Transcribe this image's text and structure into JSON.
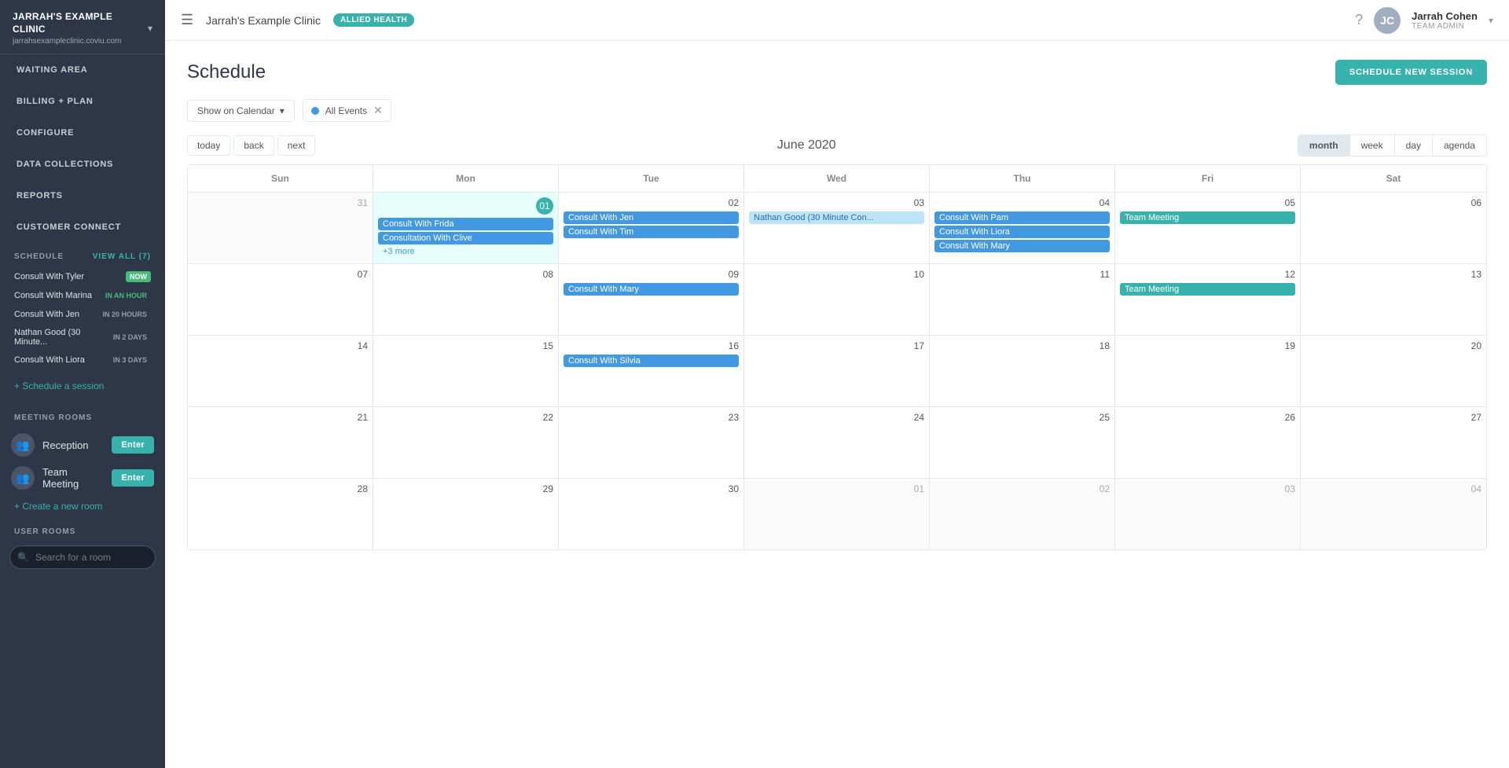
{
  "sidebar": {
    "brand": {
      "name": "JARRAH'S EXAMPLE CLINIC",
      "url": "jarrahsexampleclinic.coviu.com"
    },
    "navItems": [
      {
        "id": "waiting-area",
        "label": "WAITING AREA"
      },
      {
        "id": "billing-plan",
        "label": "BILLING + PLAN"
      },
      {
        "id": "configure",
        "label": "CONFIGURE"
      },
      {
        "id": "data-collections",
        "label": "DATA COLLECTIONS"
      },
      {
        "id": "reports",
        "label": "REPORTS"
      },
      {
        "id": "customer-connect",
        "label": "CUSTOMER CONNECT"
      }
    ],
    "schedule": {
      "header": "SCHEDULE",
      "viewAllLabel": "VIEW ALL (7)",
      "items": [
        {
          "name": "Consult With Tyler",
          "badge": "NOW",
          "badgeType": "now"
        },
        {
          "name": "Consult With Marina",
          "badge": "IN AN HOUR",
          "badgeType": "hour"
        },
        {
          "name": "Consult With Jen",
          "badge": "IN 20 HOURS",
          "badgeType": "hours"
        },
        {
          "name": "Nathan Good (30 Minute...",
          "badge": "IN 2 DAYS",
          "badgeType": "days"
        },
        {
          "name": "Consult With Liora",
          "badge": "IN 3 DAYS",
          "badgeType": "days"
        }
      ],
      "scheduleSessionLabel": "+ Schedule a session"
    },
    "meetingRooms": {
      "header": "MEETING ROOMS",
      "rooms": [
        {
          "name": "Reception",
          "enterLabel": "Enter"
        },
        {
          "name": "Team Meeting",
          "enterLabel": "Enter"
        }
      ],
      "createRoomLabel": "+ Create a new room"
    },
    "userRooms": {
      "header": "USER ROOMS",
      "searchPlaceholder": "Search for a room"
    }
  },
  "topbar": {
    "clinicName": "Jarrah's Example Clinic",
    "badge": "ALLIED HEALTH",
    "userName": "Jarrah Cohen",
    "userRole": "TEAM ADMIN",
    "avatarInitials": "JC"
  },
  "schedule": {
    "title": "Schedule",
    "newSessionLabel": "SCHEDULE NEW SESSION",
    "filterLabel": "Show on Calendar",
    "allEventsLabel": "All Events",
    "monthLabel": "June 2020",
    "navButtons": {
      "today": "today",
      "back": "back",
      "next": "next"
    },
    "viewButtons": [
      "month",
      "week",
      "day",
      "agenda"
    ],
    "activeView": "month",
    "headers": [
      "Sun",
      "Mon",
      "Tue",
      "Wed",
      "Thu",
      "Fri",
      "Sat"
    ],
    "weeks": [
      {
        "days": [
          {
            "date": "31",
            "monthType": "other",
            "events": []
          },
          {
            "date": "01",
            "monthType": "current",
            "today": true,
            "events": [
              {
                "label": "Consult With Frida",
                "type": "blue"
              },
              {
                "label": "Consultation With Clive",
                "type": "blue"
              },
              {
                "label": "+3 more",
                "type": "more"
              }
            ]
          },
          {
            "date": "02",
            "monthType": "current",
            "events": [
              {
                "label": "Consult With Jen",
                "type": "blue"
              },
              {
                "label": "Consult With Tim",
                "type": "blue"
              }
            ]
          },
          {
            "date": "03",
            "monthType": "current",
            "events": [
              {
                "label": "Nathan Good (30 Minute Con...",
                "type": "light-blue"
              }
            ]
          },
          {
            "date": "04",
            "monthType": "current",
            "events": [
              {
                "label": "Consult With Pam",
                "type": "blue"
              },
              {
                "label": "Consult With Liora",
                "type": "blue"
              },
              {
                "label": "Consult With Mary",
                "type": "blue"
              }
            ]
          },
          {
            "date": "05",
            "monthType": "current",
            "events": [
              {
                "label": "Team Meeting",
                "type": "teal"
              }
            ]
          },
          {
            "date": "06",
            "monthType": "current",
            "events": []
          }
        ]
      },
      {
        "days": [
          {
            "date": "07",
            "monthType": "current",
            "events": []
          },
          {
            "date": "08",
            "monthType": "current",
            "events": []
          },
          {
            "date": "09",
            "monthType": "current",
            "events": [
              {
                "label": "Consult With Mary",
                "type": "blue"
              }
            ]
          },
          {
            "date": "10",
            "monthType": "current",
            "events": []
          },
          {
            "date": "11",
            "monthType": "current",
            "events": []
          },
          {
            "date": "12",
            "monthType": "current",
            "events": [
              {
                "label": "Team Meeting",
                "type": "teal"
              }
            ]
          },
          {
            "date": "13",
            "monthType": "current",
            "events": []
          }
        ]
      },
      {
        "days": [
          {
            "date": "14",
            "monthType": "current",
            "events": []
          },
          {
            "date": "15",
            "monthType": "current",
            "events": []
          },
          {
            "date": "16",
            "monthType": "current",
            "events": [
              {
                "label": "Consult With Silvia",
                "type": "blue"
              }
            ]
          },
          {
            "date": "17",
            "monthType": "current",
            "events": []
          },
          {
            "date": "18",
            "monthType": "current",
            "events": []
          },
          {
            "date": "19",
            "monthType": "current",
            "events": []
          },
          {
            "date": "20",
            "monthType": "current",
            "events": []
          }
        ]
      },
      {
        "days": [
          {
            "date": "21",
            "monthType": "current",
            "events": []
          },
          {
            "date": "22",
            "monthType": "current",
            "events": []
          },
          {
            "date": "23",
            "monthType": "current",
            "events": []
          },
          {
            "date": "24",
            "monthType": "current",
            "events": []
          },
          {
            "date": "25",
            "monthType": "current",
            "events": []
          },
          {
            "date": "26",
            "monthType": "current",
            "events": []
          },
          {
            "date": "27",
            "monthType": "current",
            "events": []
          }
        ]
      },
      {
        "days": [
          {
            "date": "28",
            "monthType": "current",
            "events": []
          },
          {
            "date": "29",
            "monthType": "current",
            "events": []
          },
          {
            "date": "30",
            "monthType": "current",
            "events": []
          },
          {
            "date": "01",
            "monthType": "other",
            "events": []
          },
          {
            "date": "02",
            "monthType": "other",
            "events": []
          },
          {
            "date": "03",
            "monthType": "other",
            "events": []
          },
          {
            "date": "04",
            "monthType": "other",
            "events": []
          }
        ]
      }
    ]
  }
}
